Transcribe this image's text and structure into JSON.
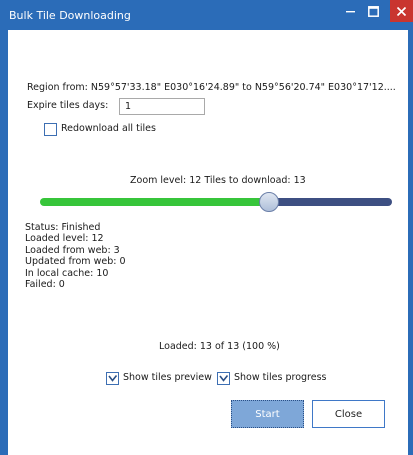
{
  "window": {
    "title": "Bulk Tile Downloading"
  },
  "region_text": "Region from: N59°57'33.18\" E030°16'24.89\" to N59°56'20.74\" E030°17'12....",
  "expire": {
    "label": "Expire tiles days:",
    "value": "1"
  },
  "redownload": {
    "label": "Redownload all tiles",
    "checked": false
  },
  "zoom": {
    "text": "Zoom level: 12 Tiles to download: 13",
    "slider_fraction": 0.65
  },
  "status_lines": [
    "Status: Finished",
    "Loaded level: 12",
    "Loaded from web: 3",
    "Updated from web: 0",
    "In local cache: 10",
    "Failed: 0"
  ],
  "loaded_text": "Loaded: 13 of 13 (100 %)",
  "options": {
    "preview_label": "Show tiles preview",
    "preview_checked": true,
    "progress_label": "Show tiles progress",
    "progress_checked": true
  },
  "buttons": {
    "start": "Start",
    "close": "Close"
  },
  "colors": {
    "titlebar": "#2b6cb8",
    "close_button": "#c9352f",
    "slider_filled": "#37c53a",
    "slider_remaining": "#3d4f82",
    "start_button": "#7ea7d8"
  }
}
